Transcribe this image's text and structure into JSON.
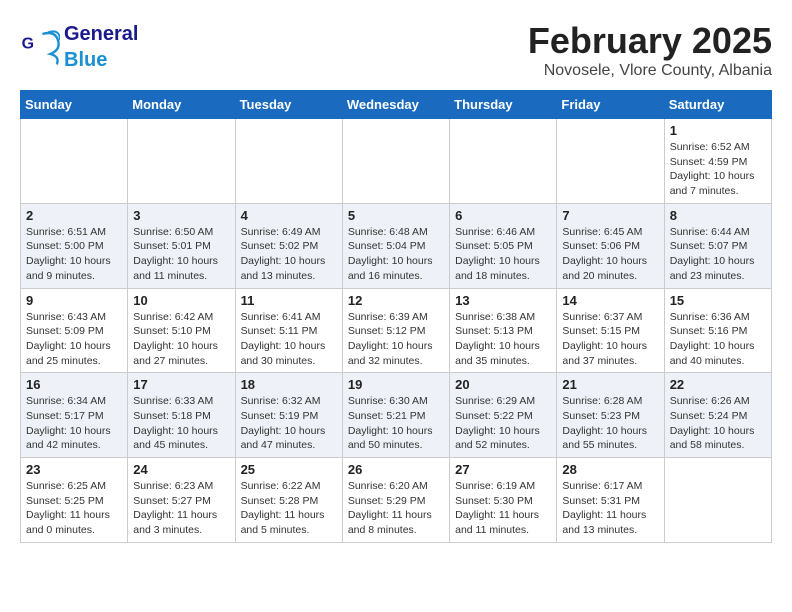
{
  "logo": {
    "general": "General",
    "blue": "Blue"
  },
  "title": "February 2025",
  "subtitle": "Novosele, Vlore County, Albania",
  "days_of_week": [
    "Sunday",
    "Monday",
    "Tuesday",
    "Wednesday",
    "Thursday",
    "Friday",
    "Saturday"
  ],
  "weeks": [
    [
      {
        "day": "",
        "info": ""
      },
      {
        "day": "",
        "info": ""
      },
      {
        "day": "",
        "info": ""
      },
      {
        "day": "",
        "info": ""
      },
      {
        "day": "",
        "info": ""
      },
      {
        "day": "",
        "info": ""
      },
      {
        "day": "1",
        "info": "Sunrise: 6:52 AM\nSunset: 4:59 PM\nDaylight: 10 hours and 7 minutes."
      }
    ],
    [
      {
        "day": "2",
        "info": "Sunrise: 6:51 AM\nSunset: 5:00 PM\nDaylight: 10 hours and 9 minutes."
      },
      {
        "day": "3",
        "info": "Sunrise: 6:50 AM\nSunset: 5:01 PM\nDaylight: 10 hours and 11 minutes."
      },
      {
        "day": "4",
        "info": "Sunrise: 6:49 AM\nSunset: 5:02 PM\nDaylight: 10 hours and 13 minutes."
      },
      {
        "day": "5",
        "info": "Sunrise: 6:48 AM\nSunset: 5:04 PM\nDaylight: 10 hours and 16 minutes."
      },
      {
        "day": "6",
        "info": "Sunrise: 6:46 AM\nSunset: 5:05 PM\nDaylight: 10 hours and 18 minutes."
      },
      {
        "day": "7",
        "info": "Sunrise: 6:45 AM\nSunset: 5:06 PM\nDaylight: 10 hours and 20 minutes."
      },
      {
        "day": "8",
        "info": "Sunrise: 6:44 AM\nSunset: 5:07 PM\nDaylight: 10 hours and 23 minutes."
      }
    ],
    [
      {
        "day": "9",
        "info": "Sunrise: 6:43 AM\nSunset: 5:09 PM\nDaylight: 10 hours and 25 minutes."
      },
      {
        "day": "10",
        "info": "Sunrise: 6:42 AM\nSunset: 5:10 PM\nDaylight: 10 hours and 27 minutes."
      },
      {
        "day": "11",
        "info": "Sunrise: 6:41 AM\nSunset: 5:11 PM\nDaylight: 10 hours and 30 minutes."
      },
      {
        "day": "12",
        "info": "Sunrise: 6:39 AM\nSunset: 5:12 PM\nDaylight: 10 hours and 32 minutes."
      },
      {
        "day": "13",
        "info": "Sunrise: 6:38 AM\nSunset: 5:13 PM\nDaylight: 10 hours and 35 minutes."
      },
      {
        "day": "14",
        "info": "Sunrise: 6:37 AM\nSunset: 5:15 PM\nDaylight: 10 hours and 37 minutes."
      },
      {
        "day": "15",
        "info": "Sunrise: 6:36 AM\nSunset: 5:16 PM\nDaylight: 10 hours and 40 minutes."
      }
    ],
    [
      {
        "day": "16",
        "info": "Sunrise: 6:34 AM\nSunset: 5:17 PM\nDaylight: 10 hours and 42 minutes."
      },
      {
        "day": "17",
        "info": "Sunrise: 6:33 AM\nSunset: 5:18 PM\nDaylight: 10 hours and 45 minutes."
      },
      {
        "day": "18",
        "info": "Sunrise: 6:32 AM\nSunset: 5:19 PM\nDaylight: 10 hours and 47 minutes."
      },
      {
        "day": "19",
        "info": "Sunrise: 6:30 AM\nSunset: 5:21 PM\nDaylight: 10 hours and 50 minutes."
      },
      {
        "day": "20",
        "info": "Sunrise: 6:29 AM\nSunset: 5:22 PM\nDaylight: 10 hours and 52 minutes."
      },
      {
        "day": "21",
        "info": "Sunrise: 6:28 AM\nSunset: 5:23 PM\nDaylight: 10 hours and 55 minutes."
      },
      {
        "day": "22",
        "info": "Sunrise: 6:26 AM\nSunset: 5:24 PM\nDaylight: 10 hours and 58 minutes."
      }
    ],
    [
      {
        "day": "23",
        "info": "Sunrise: 6:25 AM\nSunset: 5:25 PM\nDaylight: 11 hours and 0 minutes."
      },
      {
        "day": "24",
        "info": "Sunrise: 6:23 AM\nSunset: 5:27 PM\nDaylight: 11 hours and 3 minutes."
      },
      {
        "day": "25",
        "info": "Sunrise: 6:22 AM\nSunset: 5:28 PM\nDaylight: 11 hours and 5 minutes."
      },
      {
        "day": "26",
        "info": "Sunrise: 6:20 AM\nSunset: 5:29 PM\nDaylight: 11 hours and 8 minutes."
      },
      {
        "day": "27",
        "info": "Sunrise: 6:19 AM\nSunset: 5:30 PM\nDaylight: 11 hours and 11 minutes."
      },
      {
        "day": "28",
        "info": "Sunrise: 6:17 AM\nSunset: 5:31 PM\nDaylight: 11 hours and 13 minutes."
      },
      {
        "day": "",
        "info": ""
      }
    ]
  ]
}
